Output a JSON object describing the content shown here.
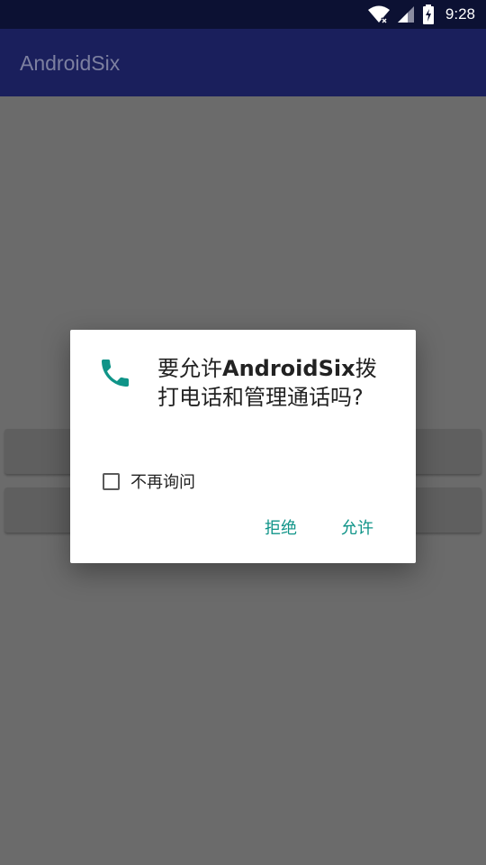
{
  "status_bar": {
    "time": "9:28",
    "icons": [
      "wifi-icon",
      "cell-signal-icon",
      "battery-charging-icon"
    ]
  },
  "app_bar": {
    "title": "AndroidSix"
  },
  "dialog": {
    "icon": "phone-icon",
    "accent_color": "#0f9488",
    "message_prefix": "要允许",
    "message_app": "AndroidSix",
    "message_suffix": "拨打电话和管理通话吗?",
    "dont_ask_label": "不再询问",
    "dont_ask_checked": false,
    "deny_label": "拒绝",
    "allow_label": "允许"
  }
}
